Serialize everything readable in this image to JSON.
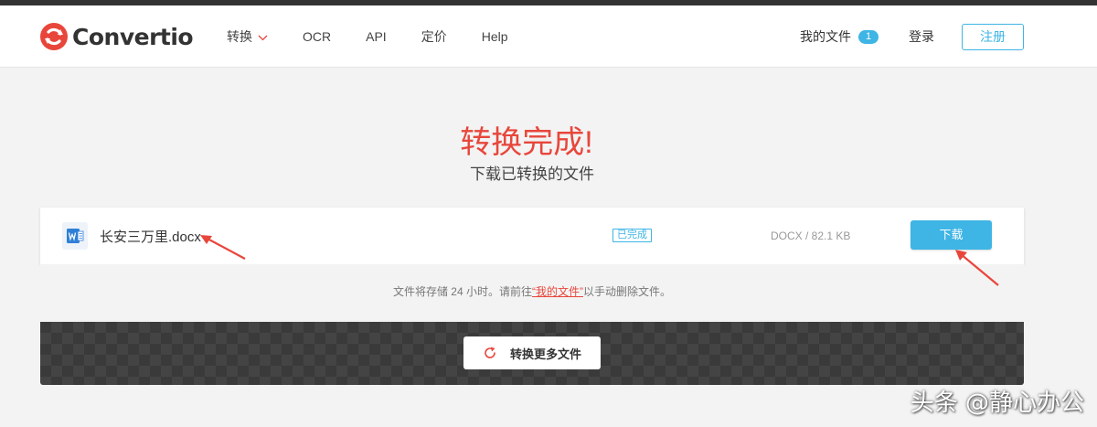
{
  "brand": {
    "name": "Convertio"
  },
  "nav": {
    "items": [
      {
        "label": "转换",
        "has_dropdown": true
      },
      {
        "label": "OCR"
      },
      {
        "label": "API"
      },
      {
        "label": "定价"
      },
      {
        "label": "Help"
      }
    ]
  },
  "header_right": {
    "my_files_label": "我的文件",
    "my_files_count": "1",
    "login_label": "登录",
    "signup_label": "注册"
  },
  "hero": {
    "title": "转换完成!",
    "subtitle": "下载已转换的文件"
  },
  "file": {
    "name": "长安三万里.docx",
    "status": "已完成",
    "meta": "DOCX / 82.1 KB",
    "download_label": "下载",
    "icon": "word-doc-icon"
  },
  "note": {
    "before": "文件将存储 24 小时。请前往",
    "link": "“我的文件”",
    "after": "以手动删除文件。"
  },
  "more_button": {
    "label": "转换更多文件",
    "icon": "refresh-icon"
  },
  "watermark": "头条 @静心办公",
  "colors": {
    "accent_red": "#e8463b",
    "accent_blue": "#3eb5e5",
    "dark_band": "#3a3a3a"
  }
}
